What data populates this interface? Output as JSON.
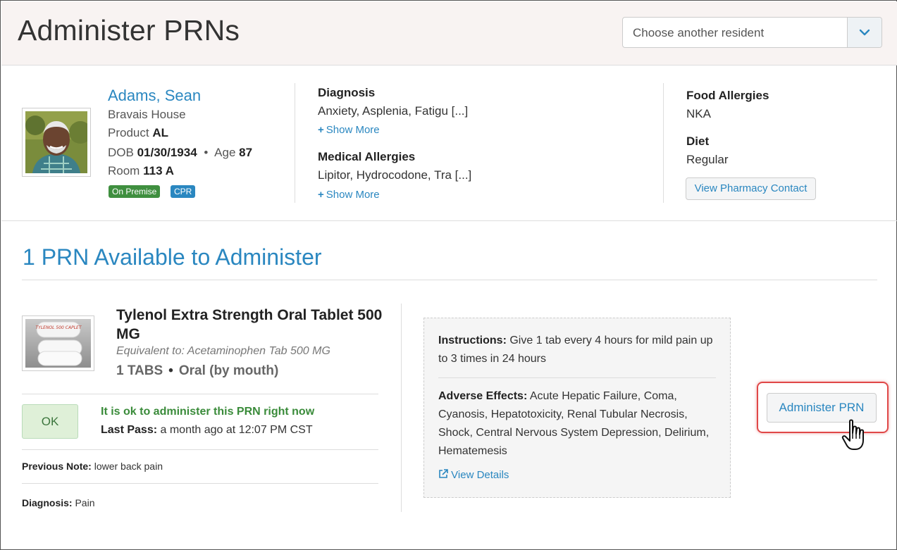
{
  "header": {
    "title": "Administer PRNs",
    "resident_select_placeholder": "Choose another resident"
  },
  "resident": {
    "name": "Adams, Sean",
    "facility": "Bravais House",
    "product_label": "Product",
    "product": "AL",
    "dob_label": "DOB",
    "dob": "01/30/1934",
    "age_label": "Age",
    "age": "87",
    "room_label": "Room",
    "room": "113 A",
    "badges": [
      "On Premise",
      "CPR"
    ]
  },
  "clinical": {
    "diagnosis_label": "Diagnosis",
    "diagnosis": "Anxiety, Asplenia, Fatigu [...]",
    "medical_allergies_label": "Medical Allergies",
    "medical_allergies": "Lipitor, Hydrocodone, Tra [...]",
    "show_more": "Show More"
  },
  "other_info": {
    "food_allergies_label": "Food Allergies",
    "food_allergies": "NKA",
    "diet_label": "Diet",
    "diet": "Regular",
    "pharmacy_button": "View Pharmacy Contact"
  },
  "prn": {
    "available_title": "1 PRN Available to Administer",
    "med_name": "Tylenol Extra Strength Oral Tablet 500 MG",
    "equivalent": "Equivalent to: Acetaminophen Tab 500 MG",
    "quantity": "1 TABS",
    "route": "Oral (by mouth)",
    "status_box": "OK",
    "status_message": "It is ok to administer this PRN right now",
    "last_pass_label": "Last Pass:",
    "last_pass": "a month ago at 12:07 PM CST",
    "previous_note_label": "Previous Note:",
    "previous_note": "lower back pain",
    "diagnosis_label": "Diagnosis:",
    "diagnosis": "Pain",
    "instructions_label": "Instructions:",
    "instructions": "Give 1 tab every 4 hours for mild pain up to 3 times in 24 hours",
    "adverse_label": "Adverse Effects:",
    "adverse": "Acute Hepatic Failure, Coma, Cyanosis, Hepatotoxicity, Renal Tubular Necrosis, Shock, Central Nervous System Depression, Delirium, Hematemesis",
    "view_details": "View Details",
    "administer_button": "Administer PRN",
    "pill_imprint": "TYLENOL 500 CAPLET"
  },
  "colors": {
    "link": "#2a87c0",
    "ok_green": "#3a8b3a",
    "highlight_red": "#e04848",
    "header_bg": "#f8f3f2"
  }
}
